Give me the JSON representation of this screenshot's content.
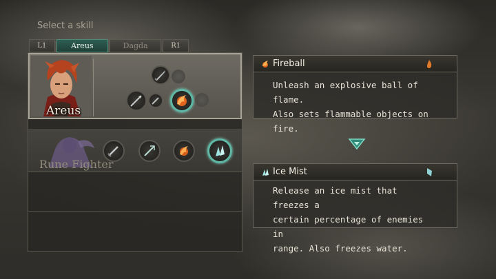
{
  "header": {
    "label": "Select a skill"
  },
  "tabs": [
    {
      "label": "L1",
      "active": false
    },
    {
      "label": "Areus",
      "active": true
    },
    {
      "label": "Dagda",
      "active": false
    },
    {
      "label": "R1",
      "active": false
    }
  ],
  "party": [
    {
      "name": "Areus",
      "skills": [
        "sword",
        "empty",
        "spear",
        "dagger",
        "fireball",
        "empty"
      ]
    },
    {
      "name": "Rune Fighter",
      "skills": [
        "sword",
        "trident",
        "fireball",
        "ice-mist"
      ]
    }
  ],
  "selected_skill": {
    "name": "Fireball",
    "description_lines": [
      "Unleash an explosive ball of flame.",
      "Also sets flammable objects on fire."
    ],
    "icon": "fire-icon",
    "element_icon": "flame-element-icon"
  },
  "compare_skill": {
    "name": "Ice Mist",
    "description_lines": [
      "Release an ice mist that freezes a",
      "certain percentage of enemies in",
      "range. Also freezes water."
    ],
    "icon": "ice-shard-icon",
    "element_icon": "ice-element-icon"
  },
  "colors": {
    "accent": "#5fb8a6",
    "panel": "#2d2c28",
    "text": "#e7e3d7"
  }
}
